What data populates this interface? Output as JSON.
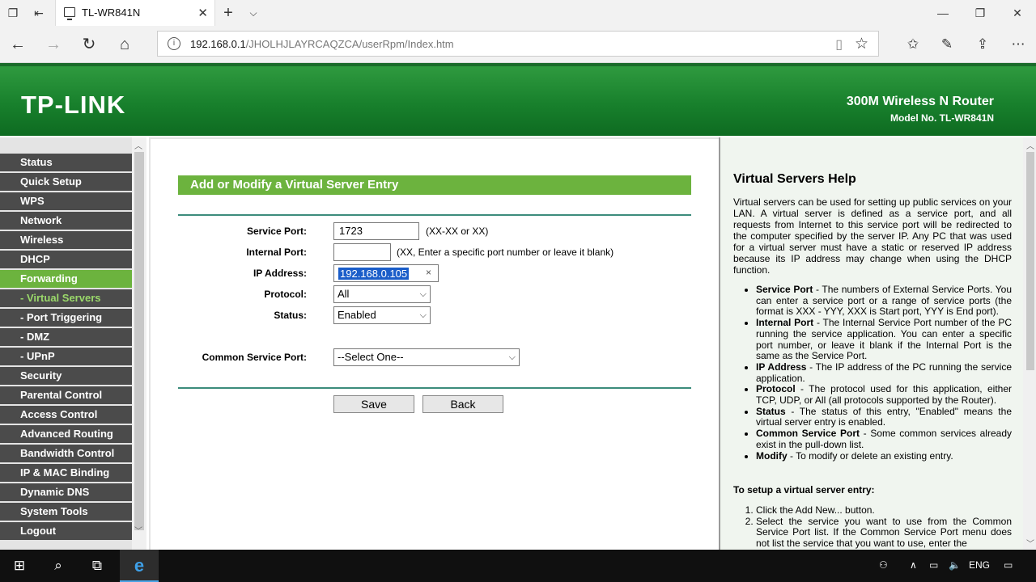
{
  "browser": {
    "tab_title": "TL-WR841N",
    "url_host": "192.168.0.1",
    "url_path": "/JHOLHJLAYRCAQZCA/userRpm/Index.htm"
  },
  "header": {
    "logo": "TP-LINK",
    "product": "300M Wireless N Router",
    "model": "Model No. TL-WR841N"
  },
  "sidebar": {
    "items": [
      {
        "label": "Status"
      },
      {
        "label": "Quick Setup"
      },
      {
        "label": "WPS"
      },
      {
        "label": "Network"
      },
      {
        "label": "Wireless"
      },
      {
        "label": "DHCP"
      },
      {
        "label": "Forwarding"
      },
      {
        "label": "- Virtual Servers"
      },
      {
        "label": "- Port Triggering"
      },
      {
        "label": "- DMZ"
      },
      {
        "label": "- UPnP"
      },
      {
        "label": "Security"
      },
      {
        "label": "Parental Control"
      },
      {
        "label": "Access Control"
      },
      {
        "label": "Advanced Routing"
      },
      {
        "label": "Bandwidth Control"
      },
      {
        "label": "IP & MAC Binding"
      },
      {
        "label": "Dynamic DNS"
      },
      {
        "label": "System Tools"
      },
      {
        "label": "Logout"
      }
    ]
  },
  "form": {
    "title": "Add or Modify a Virtual Server Entry",
    "service_port_label": "Service Port:",
    "service_port_value": "1723",
    "service_port_hint": "(XX-XX or XX)",
    "internal_port_label": "Internal Port:",
    "internal_port_value": "",
    "internal_port_hint": "(XX, Enter a specific port number or leave it blank)",
    "ip_label": "IP Address:",
    "ip_value": "192.168.0.105",
    "protocol_label": "Protocol:",
    "protocol_value": "All",
    "status_label": "Status:",
    "status_value": "Enabled",
    "common_label": "Common Service Port:",
    "common_value": "--Select One--",
    "save": "Save",
    "back": "Back"
  },
  "help": {
    "title": "Virtual Servers Help",
    "intro": "Virtual servers can be used for setting up public services on your LAN. A virtual server is defined as a service port, and all requests from Internet to this service port will be redirected to the computer specified by the server IP. Any PC that was used for a virtual server must have a static or reserved IP address because its IP address may change when using the DHCP function.",
    "items": [
      {
        "term": "Service Port",
        "text": " - The numbers of External Service Ports. You can enter a service port or a range of service ports (the format is XXX - YYY, XXX is Start port, YYY is End port)."
      },
      {
        "term": "Internal Port",
        "text": " - The Internal Service Port number of the PC running the service application. You can enter a specific port number, or leave it blank if the Internal Port is the same as the Service Port."
      },
      {
        "term": "IP Address",
        "text": " - The IP address of the PC running the service application."
      },
      {
        "term": "Protocol",
        "text": " - The protocol used for this application, either TCP, UDP, or All (all protocols supported by the Router)."
      },
      {
        "term": "Status",
        "text": " - The status of this entry, \"Enabled\" means the virtual server entry is enabled."
      },
      {
        "term": "Common Service Port",
        "text": " - Some common services already exist in the pull-down list."
      },
      {
        "term": "Modify",
        "text": " - To modify or delete an existing entry."
      }
    ],
    "setup_title": "To setup a virtual server entry:",
    "steps": [
      "Click the Add New... button.",
      "Select the service you want to use from the Common Service Port list. If the Common Service Port menu does not list the service that you want to use, enter the"
    ]
  },
  "taskbar": {
    "lang": "ENG"
  }
}
